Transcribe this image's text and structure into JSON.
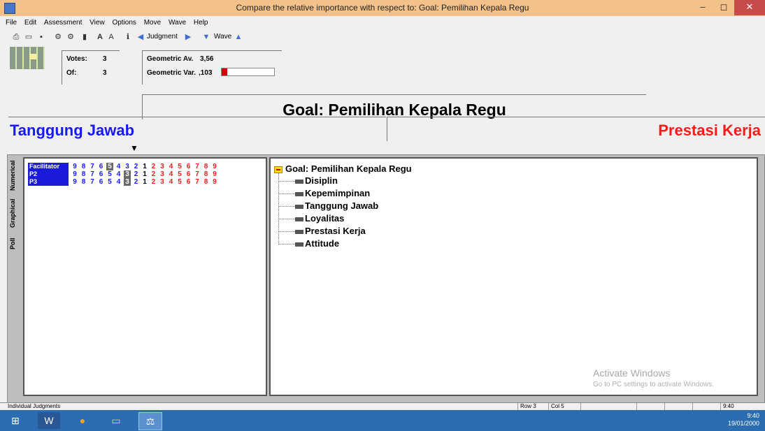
{
  "window": {
    "title": "Compare the relative importance  with respect to: Goal: Pemilihan Kepala Regu",
    "minimize": "–",
    "maximize": "◻",
    "close": "✕"
  },
  "menu": [
    "File",
    "Edit",
    "Assessment",
    "View",
    "Options",
    "Move",
    "Wave",
    "Help"
  ],
  "toolbar": {
    "judgment_label": "Judgment",
    "wave_label": "Wave"
  },
  "stats": {
    "votes_label": "Votes:",
    "votes_value": "3",
    "of_label": "Of:",
    "of_value": "3",
    "geo_av_label": "Geometric Av.",
    "geo_av_value": "3,56",
    "geo_var_label": "Geometric Var.",
    "geo_var_value": ",103",
    "geo_var_fraction": 0.1
  },
  "goal": {
    "title": "Goal: Pemilihan Kepala Regu"
  },
  "comparison": {
    "left": "Tanggung Jawab",
    "right": "Prestasi Kerja",
    "marker": "▼"
  },
  "side_tabs": [
    "Numerical",
    "Graphical",
    "Poll"
  ],
  "judgments": {
    "scale": [
      "9",
      "8",
      "7",
      "6",
      "5",
      "4",
      "3",
      "2",
      "1",
      "2",
      "3",
      "4",
      "5",
      "6",
      "7",
      "8",
      "9"
    ],
    "rows": [
      {
        "name": "Facilitator",
        "selected_index": 4
      },
      {
        "name": "P2",
        "selected_index": 6
      },
      {
        "name": "P3",
        "selected_index": 6
      }
    ]
  },
  "tree": {
    "root": "Goal: Pemilihan Kepala Regu",
    "children": [
      "Disiplin",
      "Kepemimpinan",
      "Tanggung Jawab",
      "Loyalitas",
      "Prestasi Kerja",
      "Attitude"
    ]
  },
  "watermark": {
    "line1": "Activate Windows",
    "line2": "Go to PC settings to activate Windows."
  },
  "status": {
    "left": "Individual Judgments",
    "row": "Row 3",
    "col": "Col 5",
    "time": "9:40"
  },
  "taskbar": {
    "time": "9:40",
    "date": "19/01/2000"
  },
  "colors": {
    "left_accent": "#1818ff",
    "right_accent": "#ff1a1a",
    "selected_cell": "#6a6a6a"
  }
}
